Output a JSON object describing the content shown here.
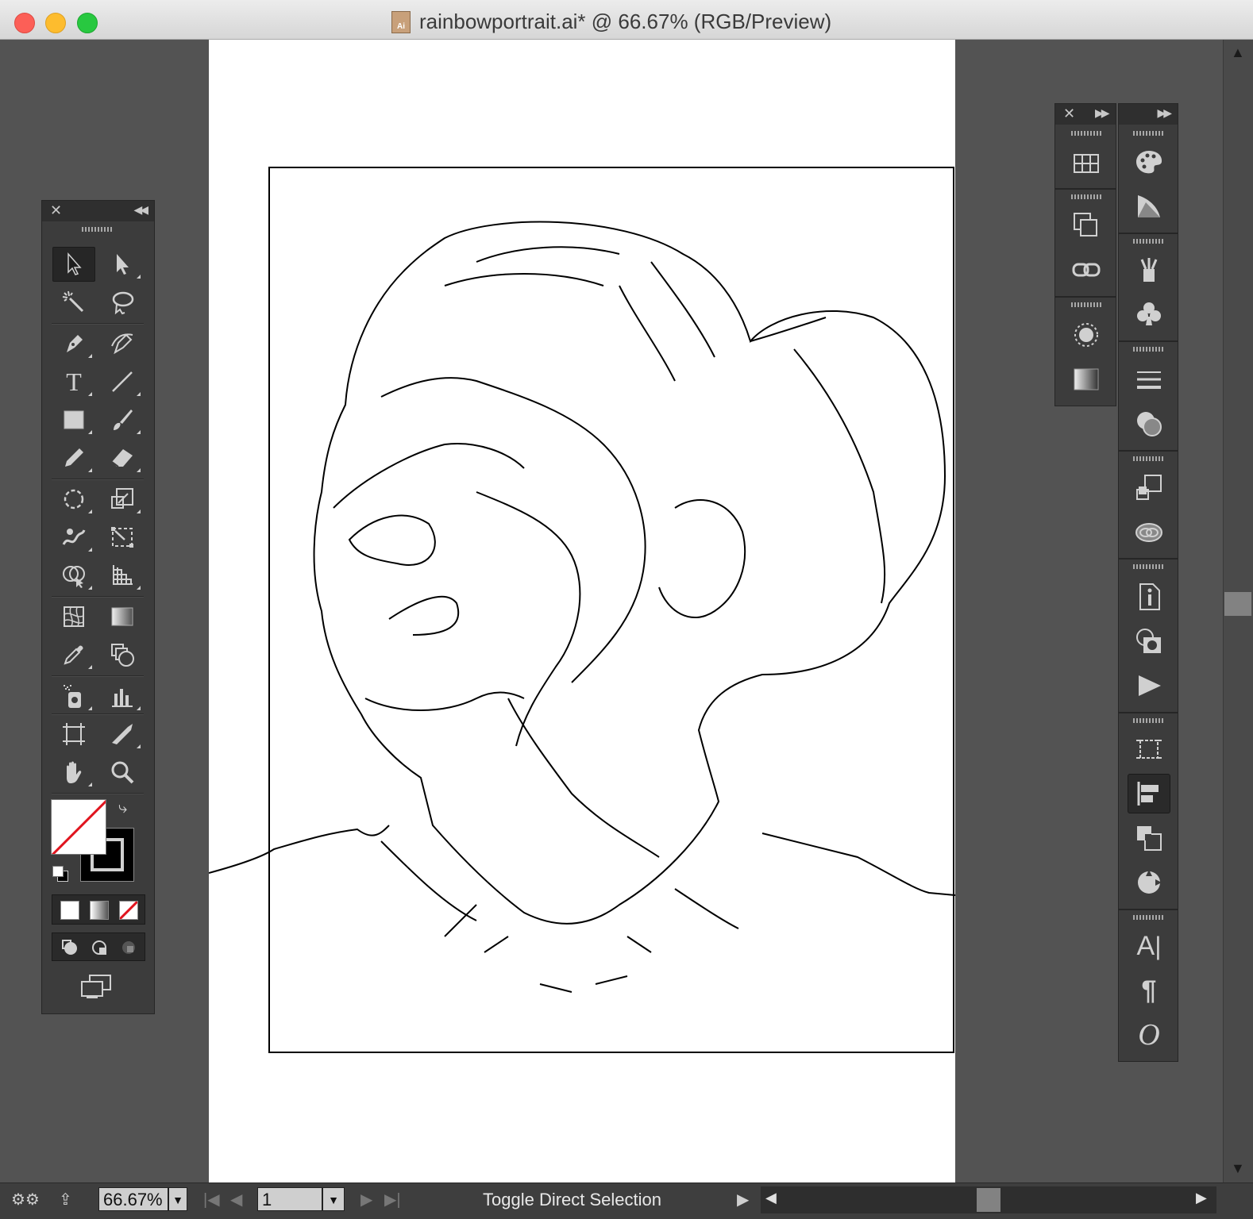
{
  "window": {
    "title": "rainbowportrait.ai* @ 66.67% (RGB/Preview)",
    "doc_icon_label": "Ai"
  },
  "tools": [
    {
      "name": "selection-tool",
      "icon": "black-arrow-icon"
    },
    {
      "name": "direct-selection-tool",
      "icon": "white-arrow-icon"
    },
    {
      "name": "magic-wand-tool",
      "icon": "magic-wand-icon"
    },
    {
      "name": "lasso-tool",
      "icon": "lasso-icon"
    },
    {
      "name": "pen-tool",
      "icon": "pen-icon"
    },
    {
      "name": "curvature-tool",
      "icon": "curvature-pen-icon"
    },
    {
      "name": "type-tool",
      "icon": "type-icon"
    },
    {
      "name": "line-segment-tool",
      "icon": "line-icon"
    },
    {
      "name": "rectangle-tool",
      "icon": "rectangle-icon"
    },
    {
      "name": "paintbrush-tool",
      "icon": "brush-icon"
    },
    {
      "name": "pencil-tool",
      "icon": "pencil-icon"
    },
    {
      "name": "eraser-tool",
      "icon": "eraser-icon"
    },
    {
      "name": "rotate-tool",
      "icon": "rotate-icon"
    },
    {
      "name": "scale-tool",
      "icon": "scale-icon"
    },
    {
      "name": "warp-tool",
      "icon": "warp-icon"
    },
    {
      "name": "free-transform-tool",
      "icon": "free-transform-icon"
    },
    {
      "name": "shape-builder-tool",
      "icon": "shape-builder-icon"
    },
    {
      "name": "perspective-grid-tool",
      "icon": "perspective-grid-icon"
    },
    {
      "name": "mesh-tool",
      "icon": "mesh-icon"
    },
    {
      "name": "gradient-tool",
      "icon": "gradient-icon"
    },
    {
      "name": "eyedropper-tool",
      "icon": "eyedropper-icon"
    },
    {
      "name": "blend-tool",
      "icon": "blend-icon"
    },
    {
      "name": "symbol-sprayer-tool",
      "icon": "symbol-sprayer-icon"
    },
    {
      "name": "column-graph-tool",
      "icon": "column-graph-icon"
    },
    {
      "name": "artboard-tool",
      "icon": "artboard-icon"
    },
    {
      "name": "slice-tool",
      "icon": "slice-icon"
    },
    {
      "name": "hand-tool",
      "icon": "hand-icon"
    },
    {
      "name": "zoom-tool",
      "icon": "zoom-icon"
    }
  ],
  "type_glyph": "T",
  "status": {
    "zoom": "66.67%",
    "artboard_number": "1",
    "message": "Toggle Direct Selection"
  },
  "colors": {
    "ui_bg": "#535353",
    "panel_bg": "#3c3c3c",
    "none_swatch_red": "#e0141e"
  },
  "right_panels": {
    "column_a": [
      "swatches-grid-icon",
      "transform-icon",
      "links-icon",
      "appearance-icon",
      "gradient-swatch-icon"
    ],
    "column_b": [
      "color-palette-icon",
      "color-guide-icon",
      "brushes-icon",
      "symbols-icon",
      "stroke-icon",
      "transparency-icon",
      "layers-icon",
      "libraries-icon",
      "document-info-icon",
      "image-trace-icon",
      "actions-icon",
      "artboards-icon",
      "align-icon",
      "pathfinder-icon",
      "navigator-icon",
      "character-icon",
      "paragraph-icon",
      "opentype-icon"
    ],
    "character_glyph": "A",
    "paragraph_glyph": "¶",
    "opentype_glyph": "O"
  }
}
